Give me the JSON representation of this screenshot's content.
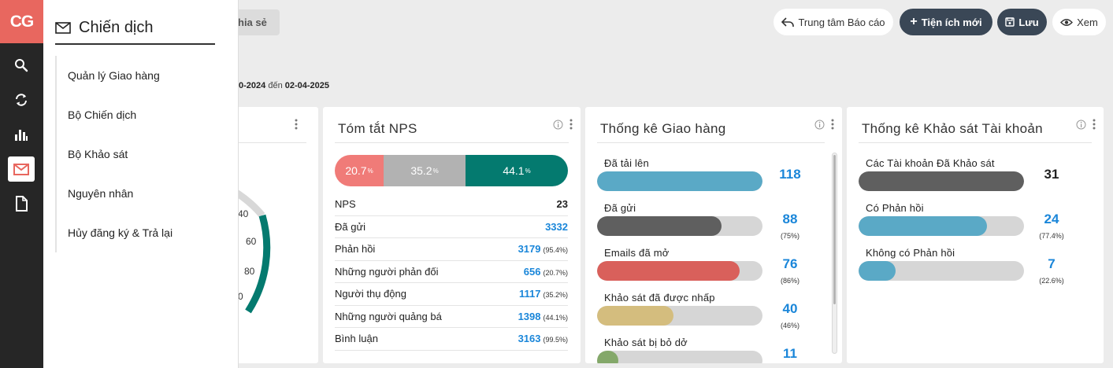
{
  "rail": {
    "logo": "CG",
    "icons": [
      "search-icon",
      "refresh-icon",
      "chart-icon",
      "mail-icon",
      "document-icon"
    ]
  },
  "flyout": {
    "title": "Chiến dịch",
    "items": [
      "Quản lý Giao hàng",
      "Bộ Chiến dịch",
      "Bộ Khảo sát",
      "Nguyên nhân",
      "Hủy đăng ký & Trả lại"
    ]
  },
  "toolbar": {
    "share_label": "hia sẻ",
    "report_center": "Trung tâm Báo cáo",
    "new_widget": "Tiện ích mới",
    "save": "Lưu",
    "view": "Xem"
  },
  "date_range": {
    "from": "0-2024",
    "sep": "đến",
    "to": "02-04-2025"
  },
  "gauge": {
    "ticks": [
      "40",
      "60",
      "80",
      "0"
    ]
  },
  "nps": {
    "title": "Tóm tắt NPS",
    "segments": [
      {
        "value": "20.7",
        "color": "#f07b78"
      },
      {
        "value": "35.2",
        "color": "#b2b2b2"
      },
      {
        "value": "44.1",
        "color": "#047a6f"
      }
    ],
    "rows": [
      {
        "label": "NPS",
        "value": "23",
        "pct": ""
      },
      {
        "label": "Đã gửi",
        "value": "3332",
        "pct": ""
      },
      {
        "label": "Phản hồi",
        "value": "3179",
        "pct": "(95.4%)"
      },
      {
        "label": "Những người phản đối",
        "value": "656",
        "pct": "(20.7%)"
      },
      {
        "label": "Người thụ động",
        "value": "1117",
        "pct": "(35.2%)"
      },
      {
        "label": "Những người quảng bá",
        "value": "1398",
        "pct": "(44.1%)"
      },
      {
        "label": "Bình luận",
        "value": "3163",
        "pct": "(99.5%)"
      }
    ]
  },
  "delivery": {
    "title": "Thống kê Giao hàng",
    "rows": [
      {
        "label": "Đã tải lên",
        "value": "118",
        "pct": "",
        "fill": 1.0,
        "color": "#5aa9c6"
      },
      {
        "label": "Đã gửi",
        "value": "88",
        "pct": "(75%)",
        "fill": 0.75,
        "color": "#5f5f5f"
      },
      {
        "label": "Emails đã mở",
        "value": "76",
        "pct": "(86%)",
        "fill": 0.86,
        "color": "#d9605b"
      },
      {
        "label": "Khảo sát đã được nhấp",
        "value": "40",
        "pct": "(46%)",
        "fill": 0.46,
        "color": "#d4bd7e"
      },
      {
        "label": "Khảo sát bị bỏ dở",
        "value": "11",
        "pct": "(13%)",
        "fill": 0.13,
        "color": "#84a86a"
      }
    ]
  },
  "account": {
    "title": "Thống kê Khảo sát Tài khoản",
    "rows": [
      {
        "label": "Các Tài khoản Đã Khảo sát",
        "value": "31",
        "pct": "",
        "fill": 1.0,
        "color": "#5f5f5f"
      },
      {
        "label": "Có Phản hồi",
        "value": "24",
        "pct": "(77.4%)",
        "fill": 0.774,
        "color": "#5aa9c6"
      },
      {
        "label": "Không có Phản hồi",
        "value": "7",
        "pct": "(22.6%)",
        "fill": 0.226,
        "color": "#5aa9c6"
      }
    ]
  }
}
